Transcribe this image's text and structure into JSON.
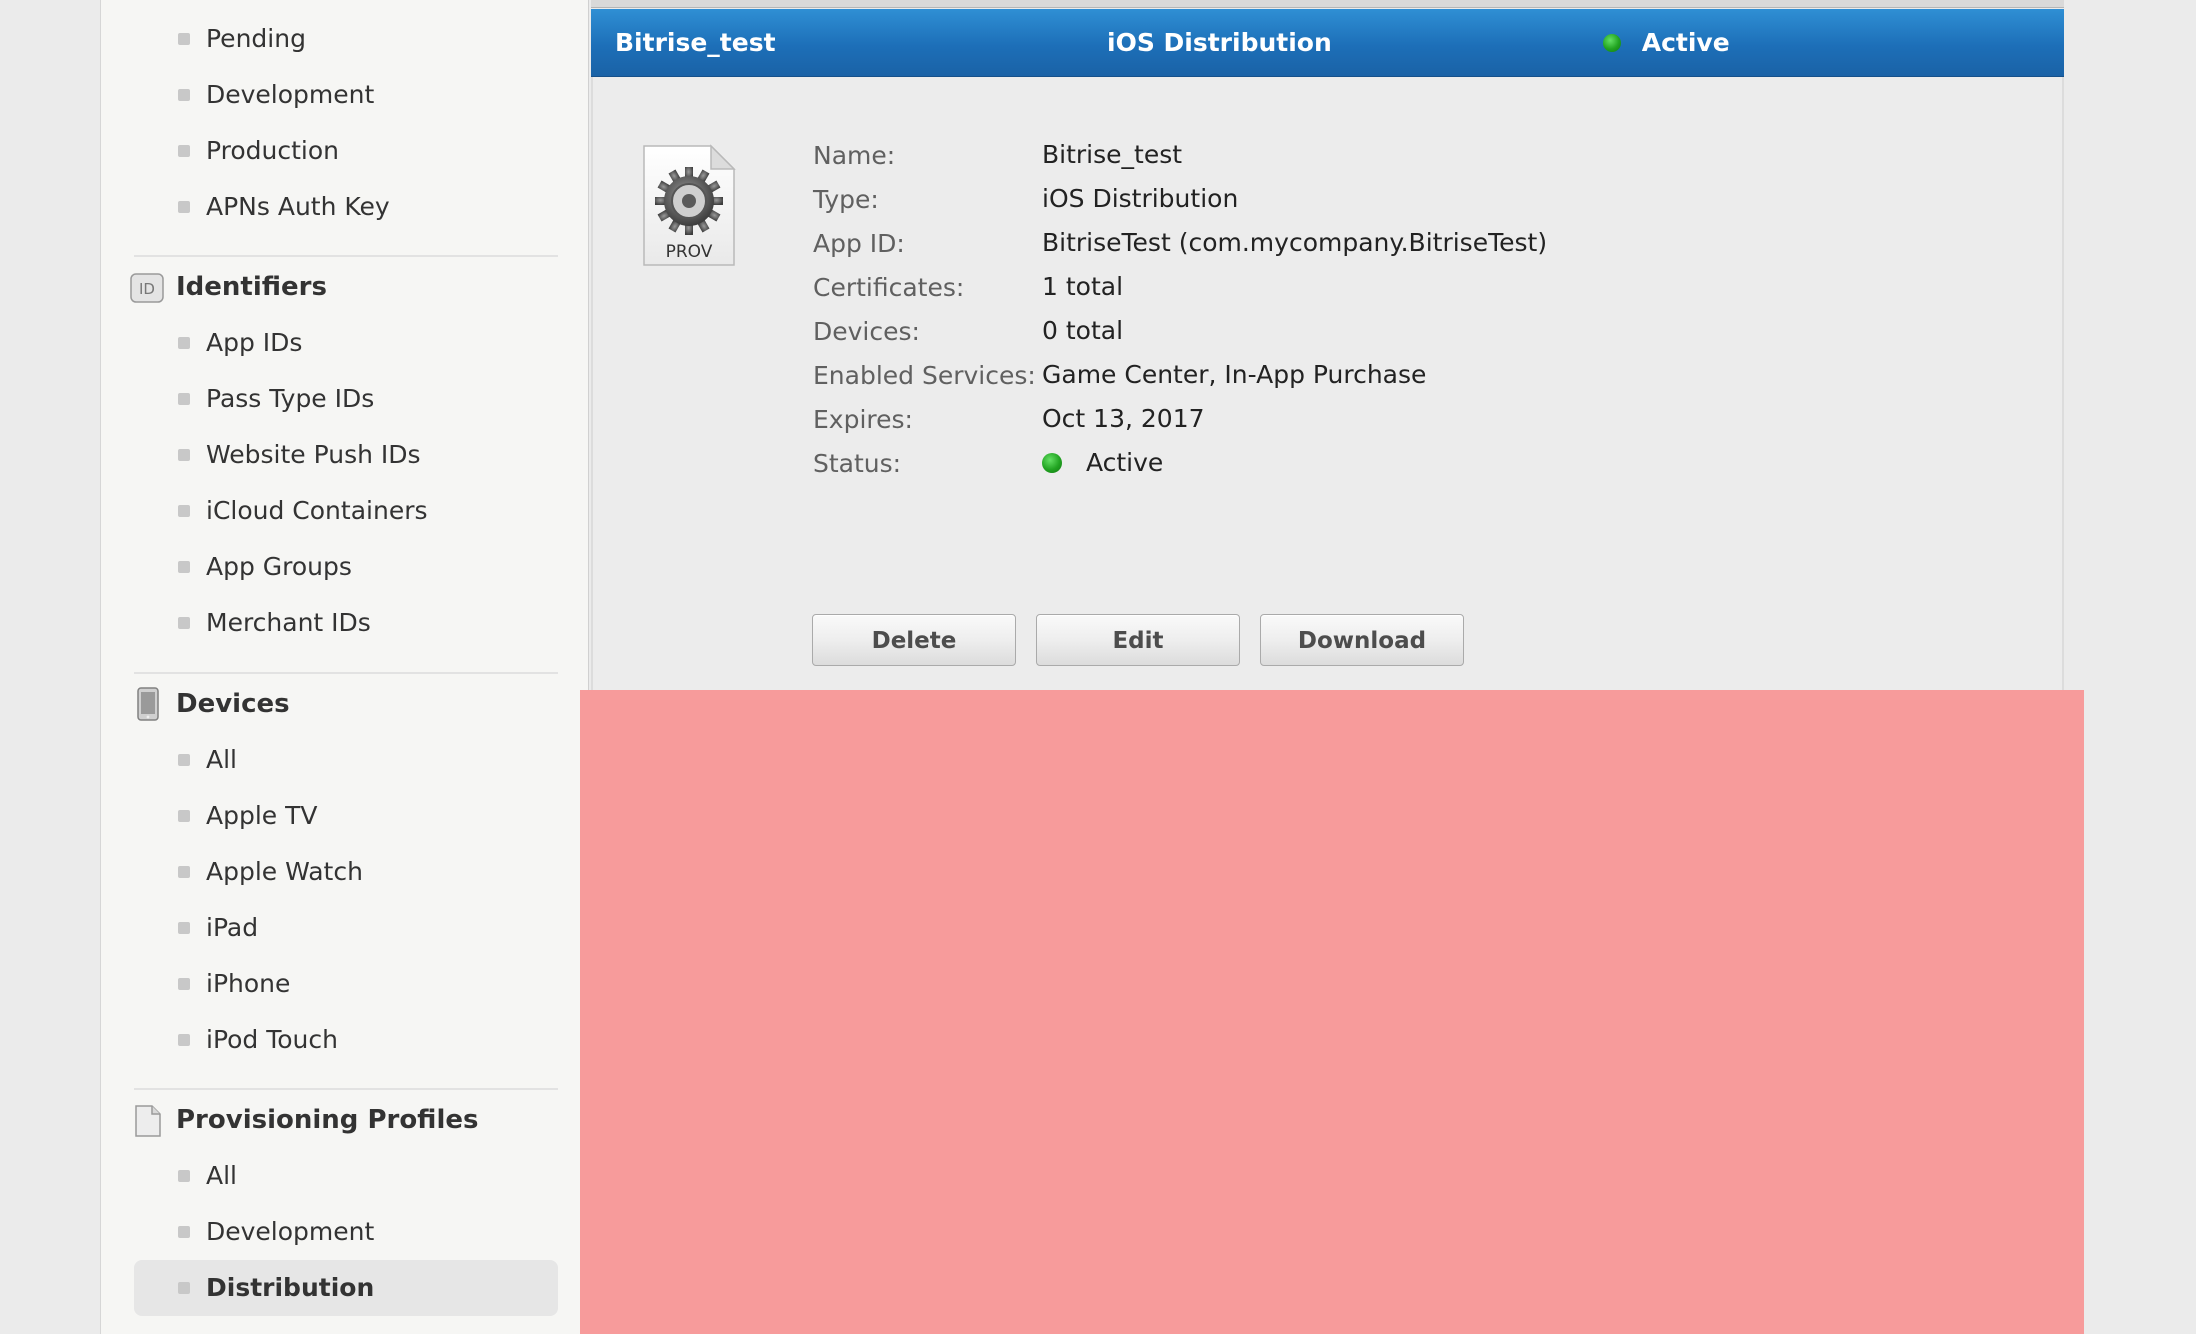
{
  "sidebar": {
    "certificates_items": [
      {
        "label": "Pending"
      },
      {
        "label": "Development"
      },
      {
        "label": "Production"
      },
      {
        "label": "APNs Auth Key"
      }
    ],
    "identifiers": {
      "title": "Identifiers",
      "icon_text": "ID",
      "items": [
        {
          "label": "App IDs"
        },
        {
          "label": "Pass Type IDs"
        },
        {
          "label": "Website Push IDs"
        },
        {
          "label": "iCloud Containers"
        },
        {
          "label": "App Groups"
        },
        {
          "label": "Merchant IDs"
        }
      ]
    },
    "devices": {
      "title": "Devices",
      "icon": "device-icon",
      "items": [
        {
          "label": "All"
        },
        {
          "label": "Apple TV"
        },
        {
          "label": "Apple Watch"
        },
        {
          "label": "iPad"
        },
        {
          "label": "iPhone"
        },
        {
          "label": "iPod Touch"
        }
      ]
    },
    "provisioning_profiles": {
      "title": "Provisioning Profiles",
      "icon": "document-icon",
      "items": [
        {
          "label": "All"
        },
        {
          "label": "Development"
        },
        {
          "label": "Distribution",
          "selected": true
        }
      ]
    }
  },
  "header": {
    "name": "Bitrise_test",
    "type": "iOS Distribution",
    "status": "Active",
    "background_color": "#1d6fb8"
  },
  "profile": {
    "icon_label": "PROV",
    "fields": [
      {
        "label": "Name:",
        "value": "Bitrise_test"
      },
      {
        "label": "Type:",
        "value": "iOS Distribution"
      },
      {
        "label": "App ID:",
        "value": "BitriseTest (com.mycompany.BitriseTest)"
      },
      {
        "label": "Certificates:",
        "value": "1 total"
      },
      {
        "label": "Devices:",
        "value": "0 total"
      },
      {
        "label": "Enabled Services:",
        "value": "Game Center, In-App Purchase"
      },
      {
        "label": "Expires:",
        "value": "Oct 13, 2017"
      },
      {
        "label": "Status:",
        "value": "Active",
        "status_color": "#21a321"
      }
    ]
  },
  "actions": {
    "delete_label": "Delete",
    "edit_label": "Edit",
    "download_label": "Download"
  },
  "redaction_color": "#f79b9b"
}
